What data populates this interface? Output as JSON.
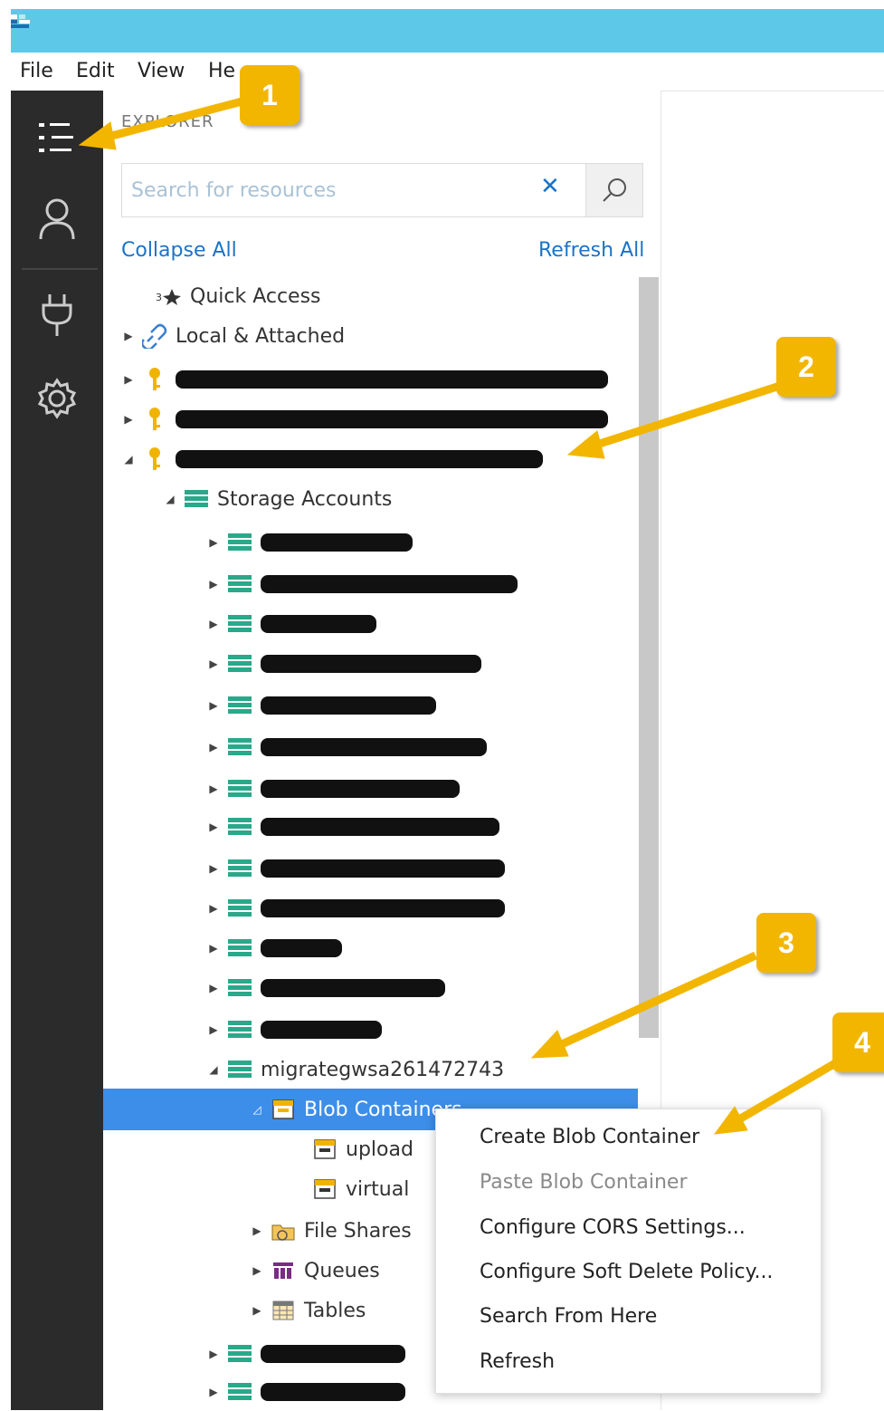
{
  "menu": {
    "file": "File",
    "edit": "Edit",
    "view": "View",
    "help": "He"
  },
  "explorer": {
    "title": "EXPLORER",
    "search_placeholder": "Search for resources",
    "collapse_all": "Collapse All",
    "refresh_all": "Refresh All"
  },
  "tree": {
    "quick_access": "Quick Access",
    "local_attached": "Local & Attached",
    "storage_accounts": "Storage Accounts",
    "account_visible": "migrategwsa261472743",
    "blob_containers": "Blob Containers",
    "container_upload": "upload",
    "container_virtual": "virtual",
    "file_shares": "File Shares",
    "queues": "Queues",
    "tables": "Tables"
  },
  "context_menu": {
    "create": "Create Blob Container",
    "paste": "Paste Blob Container",
    "cors": "Configure CORS Settings...",
    "soft_delete": "Configure Soft Delete Policy...",
    "search": "Search From Here",
    "refresh": "Refresh"
  },
  "badges": {
    "b1": "1",
    "b2": "2",
    "b3": "3",
    "b4": "4"
  },
  "colors": {
    "titlebar": "#5ec8e8",
    "selection": "#3d8ee8",
    "link": "#1a73c9",
    "badge": "#f2b600",
    "activity_bar": "#2b2b2b"
  }
}
